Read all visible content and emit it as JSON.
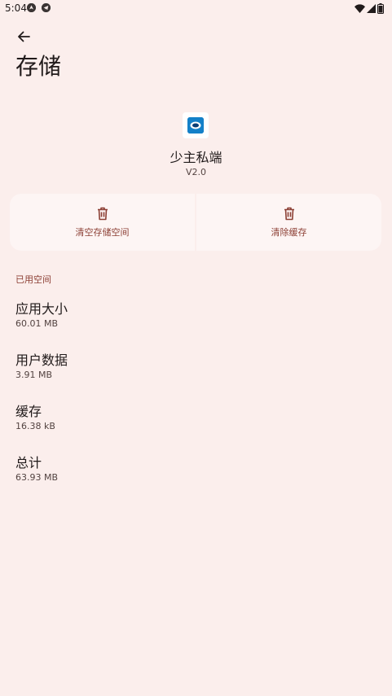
{
  "status_bar": {
    "time": "5:04",
    "left_icons": [
      "navigation-icon",
      "telegram-icon"
    ],
    "right_icons": [
      "wifi-icon",
      "signal-icon",
      "battery-icon"
    ]
  },
  "header": {
    "back_icon": "arrow-left-icon",
    "title": "存储"
  },
  "app": {
    "name": "少主私端",
    "version": "V2.0"
  },
  "actions": [
    {
      "label": "清空存储空间",
      "icon": "trash-icon"
    },
    {
      "label": "清除缓存",
      "icon": "trash-icon"
    }
  ],
  "storage": {
    "section_title": "已用空间",
    "items": [
      {
        "title": "应用大小",
        "value": "60.01 MB"
      },
      {
        "title": "用户数据",
        "value": "3.91 MB"
      },
      {
        "title": "缓存",
        "value": "16.38 kB"
      },
      {
        "title": "总计",
        "value": "63.93 MB"
      }
    ]
  },
  "colors": {
    "background": "#fbeeec",
    "accent": "#8c3f34",
    "card": "#fdf5f4",
    "text_primary": "#201a1a",
    "text_secondary": "#534341"
  }
}
